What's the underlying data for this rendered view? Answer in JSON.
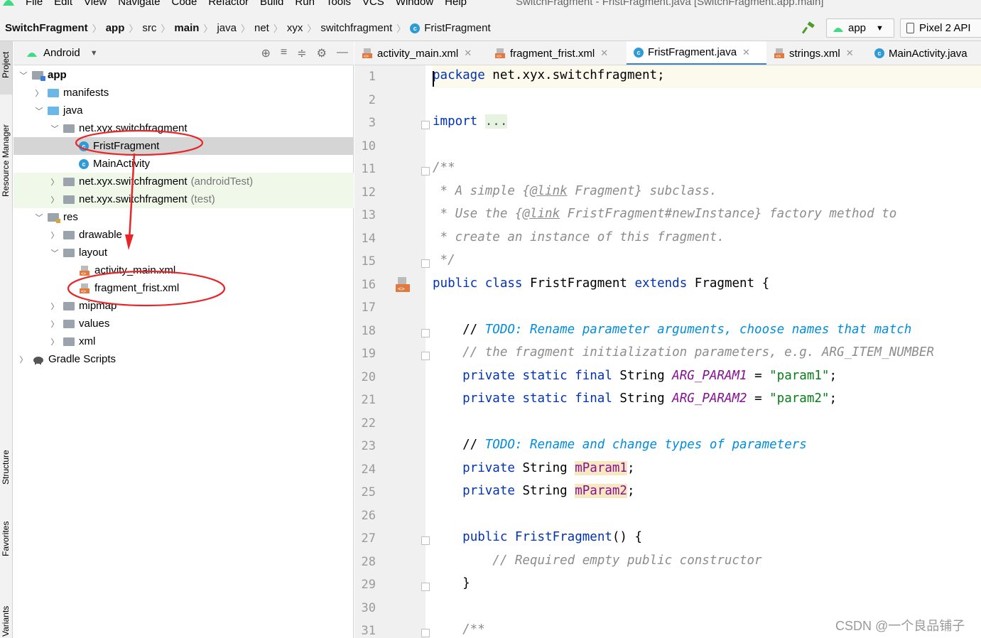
{
  "menu": {
    "items": [
      "File",
      "Edit",
      "View",
      "Navigate",
      "Code",
      "Refactor",
      "Build",
      "Run",
      "Tools",
      "VCS",
      "Window",
      "Help"
    ],
    "window_title": "SwitchFragment - FristFragment.java [SwitchFragment.app.main]"
  },
  "nav": {
    "crumbs": [
      "SwitchFragment",
      "app",
      "src",
      "main",
      "java",
      "net",
      "xyx",
      "switchfragment",
      "FristFragment"
    ],
    "run_config": "app",
    "device": "Pixel 2 API"
  },
  "side_tools": [
    "Project",
    "Resource Manager",
    "Structure",
    "Favorites",
    "Build Variants"
  ],
  "project": {
    "view": "Android",
    "tree": [
      {
        "label": "app",
        "indent": 0,
        "arrow": "down",
        "icon": "module",
        "bold": true
      },
      {
        "label": "manifests",
        "indent": 1,
        "arrow": "right",
        "icon": "folder-blue"
      },
      {
        "label": "java",
        "indent": 1,
        "arrow": "down",
        "icon": "folder-blue"
      },
      {
        "label": "net.xyx.switchfragment",
        "indent": 2,
        "arrow": "down",
        "icon": "package"
      },
      {
        "label": "FristFragment",
        "indent": 3,
        "arrow": "",
        "icon": "class",
        "selected": true
      },
      {
        "label": "MainActivity",
        "indent": 3,
        "arrow": "",
        "icon": "class"
      },
      {
        "label": "net.xyx.switchfragment",
        "suffix": "(androidTest)",
        "indent": 2,
        "arrow": "right",
        "icon": "package",
        "test": true
      },
      {
        "label": "net.xyx.switchfragment",
        "suffix": "(test)",
        "indent": 2,
        "arrow": "right",
        "icon": "package",
        "test": true
      },
      {
        "label": "res",
        "indent": 1,
        "arrow": "down",
        "icon": "folder-res"
      },
      {
        "label": "drawable",
        "indent": 2,
        "arrow": "right",
        "icon": "folder"
      },
      {
        "label": "layout",
        "indent": 2,
        "arrow": "down",
        "icon": "folder"
      },
      {
        "label": "activity_main.xml",
        "indent": 3,
        "arrow": "",
        "icon": "xml"
      },
      {
        "label": "fragment_frist.xml",
        "indent": 3,
        "arrow": "",
        "icon": "xml"
      },
      {
        "label": "mipmap",
        "indent": 2,
        "arrow": "right",
        "icon": "folder"
      },
      {
        "label": "values",
        "indent": 2,
        "arrow": "right",
        "icon": "folder"
      },
      {
        "label": "xml",
        "indent": 2,
        "arrow": "right",
        "icon": "folder"
      },
      {
        "label": "Gradle Scripts",
        "indent": 0,
        "arrow": "right",
        "icon": "gradle"
      }
    ]
  },
  "tabs": [
    {
      "label": "activity_main.xml",
      "icon": "xml"
    },
    {
      "label": "fragment_frist.xml",
      "icon": "xml"
    },
    {
      "label": "FristFragment.java",
      "icon": "class",
      "active": true
    },
    {
      "label": "strings.xml",
      "icon": "xml"
    },
    {
      "label": "MainActivity.java",
      "icon": "class"
    }
  ],
  "code": {
    "line_numbers": [
      "1",
      "2",
      "3",
      "10",
      "11",
      "12",
      "13",
      "14",
      "15",
      "16",
      "17",
      "18",
      "19",
      "20",
      "21",
      "22",
      "23",
      "24",
      "25",
      "26",
      "27",
      "28",
      "29",
      "30",
      "31"
    ],
    "lines": [
      [
        {
          "t": "package",
          "c": "kw"
        },
        {
          "t": " net.xyx.switchfragment;"
        }
      ],
      [],
      [
        {
          "t": "import",
          "c": "kw"
        },
        {
          "t": " "
        },
        {
          "t": "...",
          "c": "imp"
        }
      ],
      [],
      [
        {
          "t": "/**",
          "c": "cm"
        }
      ],
      [
        {
          "t": " * A simple {",
          "c": "cm"
        },
        {
          "t": "@link",
          "c": "cm lnk"
        },
        {
          "t": " Fragment} subclass.",
          "c": "cm"
        }
      ],
      [
        {
          "t": " * Use the {",
          "c": "cm"
        },
        {
          "t": "@link",
          "c": "cm lnk"
        },
        {
          "t": " FristFragment#newInstance} factory method to",
          "c": "cm"
        }
      ],
      [
        {
          "t": " * create an instance of this fragment.",
          "c": "cm"
        }
      ],
      [
        {
          "t": " */",
          "c": "cm"
        }
      ],
      [
        {
          "t": "public",
          "c": "kw"
        },
        {
          "t": " "
        },
        {
          "t": "class",
          "c": "kw"
        },
        {
          "t": " FristFragment "
        },
        {
          "t": "extends",
          "c": "kw"
        },
        {
          "t": " Fragment {"
        }
      ],
      [],
      [
        {
          "t": "    // "
        },
        {
          "t": "TODO: Rename parameter arguments, choose names that match",
          "c": "todo"
        }
      ],
      [
        {
          "t": "    // the fragment initialization parameters, e.g. ARG_ITEM_NUMBER",
          "c": "cm"
        }
      ],
      [
        {
          "t": "    "
        },
        {
          "t": "private static final",
          "c": "kw"
        },
        {
          "t": " String "
        },
        {
          "t": "ARG_PARAM1",
          "c": "const"
        },
        {
          "t": " = "
        },
        {
          "t": "\"param1\"",
          "c": "str"
        },
        {
          "t": ";"
        }
      ],
      [
        {
          "t": "    "
        },
        {
          "t": "private static final",
          "c": "kw"
        },
        {
          "t": " String "
        },
        {
          "t": "ARG_PARAM2",
          "c": "const"
        },
        {
          "t": " = "
        },
        {
          "t": "\"param2\"",
          "c": "str"
        },
        {
          "t": ";"
        }
      ],
      [],
      [
        {
          "t": "    // "
        },
        {
          "t": "TODO: Rename and change types of parameters",
          "c": "todo"
        }
      ],
      [
        {
          "t": "    "
        },
        {
          "t": "private",
          "c": "kw"
        },
        {
          "t": " String "
        },
        {
          "t": "mParam1",
          "c": "field"
        },
        {
          "t": ";"
        }
      ],
      [
        {
          "t": "    "
        },
        {
          "t": "private",
          "c": "kw"
        },
        {
          "t": " String "
        },
        {
          "t": "mParam2",
          "c": "field"
        },
        {
          "t": ";"
        }
      ],
      [],
      [
        {
          "t": "    "
        },
        {
          "t": "public",
          "c": "kw"
        },
        {
          "t": " "
        },
        {
          "t": "FristFragment",
          "c": "kw"
        },
        {
          "t": "() {"
        }
      ],
      [
        {
          "t": "        // Required empty public constructor",
          "c": "cm"
        }
      ],
      [
        {
          "t": "    }"
        }
      ],
      [],
      [
        {
          "t": "    /**",
          "c": "cm"
        }
      ]
    ]
  },
  "watermark": "CSDN @一个良品铺子",
  "colors": {
    "accent": "#4083c9",
    "keyword": "#0033b3",
    "annotation": "#e8262a"
  }
}
